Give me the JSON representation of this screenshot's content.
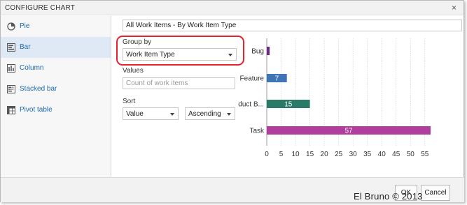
{
  "dialog": {
    "title": "CONFIGURE CHART",
    "close_glyph": "×"
  },
  "sidebar": {
    "items": [
      {
        "label": "Pie",
        "icon": "pie-chart-icon",
        "active": false
      },
      {
        "label": "Bar",
        "icon": "bar-chart-icon",
        "active": true
      },
      {
        "label": "Column",
        "icon": "column-chart-icon",
        "active": false
      },
      {
        "label": "Stacked bar",
        "icon": "stacked-bar-icon",
        "active": false
      },
      {
        "label": "Pivot table",
        "icon": "pivot-table-icon",
        "active": false
      }
    ]
  },
  "config": {
    "chart_title": "All Work Items - By Work Item Type",
    "group_by_label": "Group by",
    "group_by_value": "Work Item Type",
    "values_label": "Values",
    "values_placeholder": "Count of work items",
    "sort_label": "Sort",
    "sort_field": "Value",
    "sort_order": "Ascending"
  },
  "chart_data": {
    "type": "bar",
    "orientation": "horizontal",
    "categories": [
      "Bug",
      "Feature",
      "Product B...",
      "Task"
    ],
    "values": [
      1,
      7,
      15,
      57
    ],
    "bar_labels": [
      "",
      "7",
      "15",
      "57"
    ],
    "colors": [
      "#6d2a85",
      "#3f74b7",
      "#2a7a68",
      "#b13d9c"
    ],
    "xlim": [
      0,
      57
    ],
    "xticks": [
      "0",
      "5",
      "10",
      "15",
      "20",
      "25",
      "30",
      "35",
      "40",
      "45",
      "50",
      "55"
    ],
    "grid": true
  },
  "footer": {
    "ok_label": "OK",
    "cancel_label": "Cancel"
  },
  "watermark": "El Bruno © 2013",
  "colors": {
    "accent": "#1b6ab0",
    "selected_bg": "#dfe9f5",
    "highlight": "#e8222c"
  }
}
